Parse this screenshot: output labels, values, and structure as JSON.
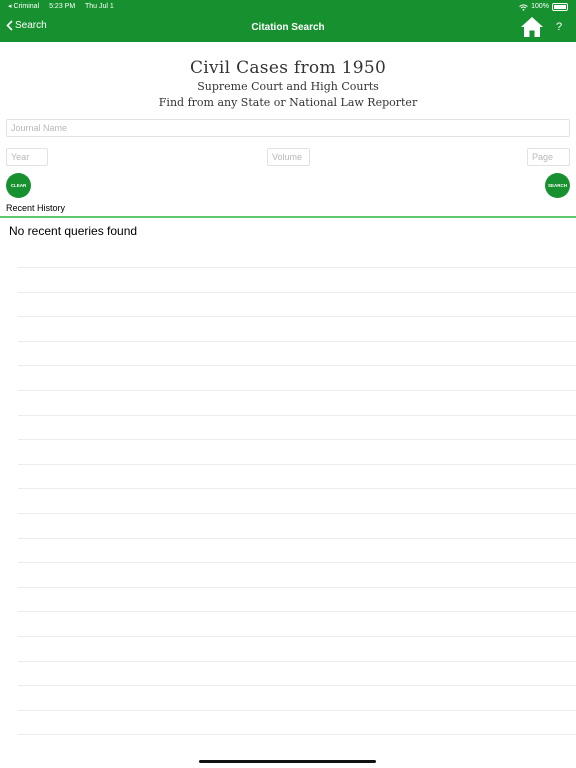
{
  "status_bar": {
    "carrier": "◂ Criminal",
    "time": "5:23 PM",
    "date": "Thu Jul 1",
    "battery": "100%"
  },
  "nav": {
    "back_label": "Search",
    "title": "Citation Search",
    "help_label": "?"
  },
  "header": {
    "title": "Civil Cases from 1950",
    "subtitle1": "Supreme Court and High Courts",
    "subtitle2": "Find from any State or National Law Reporter"
  },
  "form": {
    "journal_placeholder": "Journal Name",
    "year_placeholder": "Year",
    "volume_placeholder": "Volume",
    "page_placeholder": "Page",
    "clear_label": "CLEAR",
    "search_label": "SEARCH"
  },
  "history": {
    "label": "Recent History",
    "empty_message": "No recent queries found"
  },
  "colors": {
    "accent": "#17912f",
    "divider": "#5fc76e"
  }
}
